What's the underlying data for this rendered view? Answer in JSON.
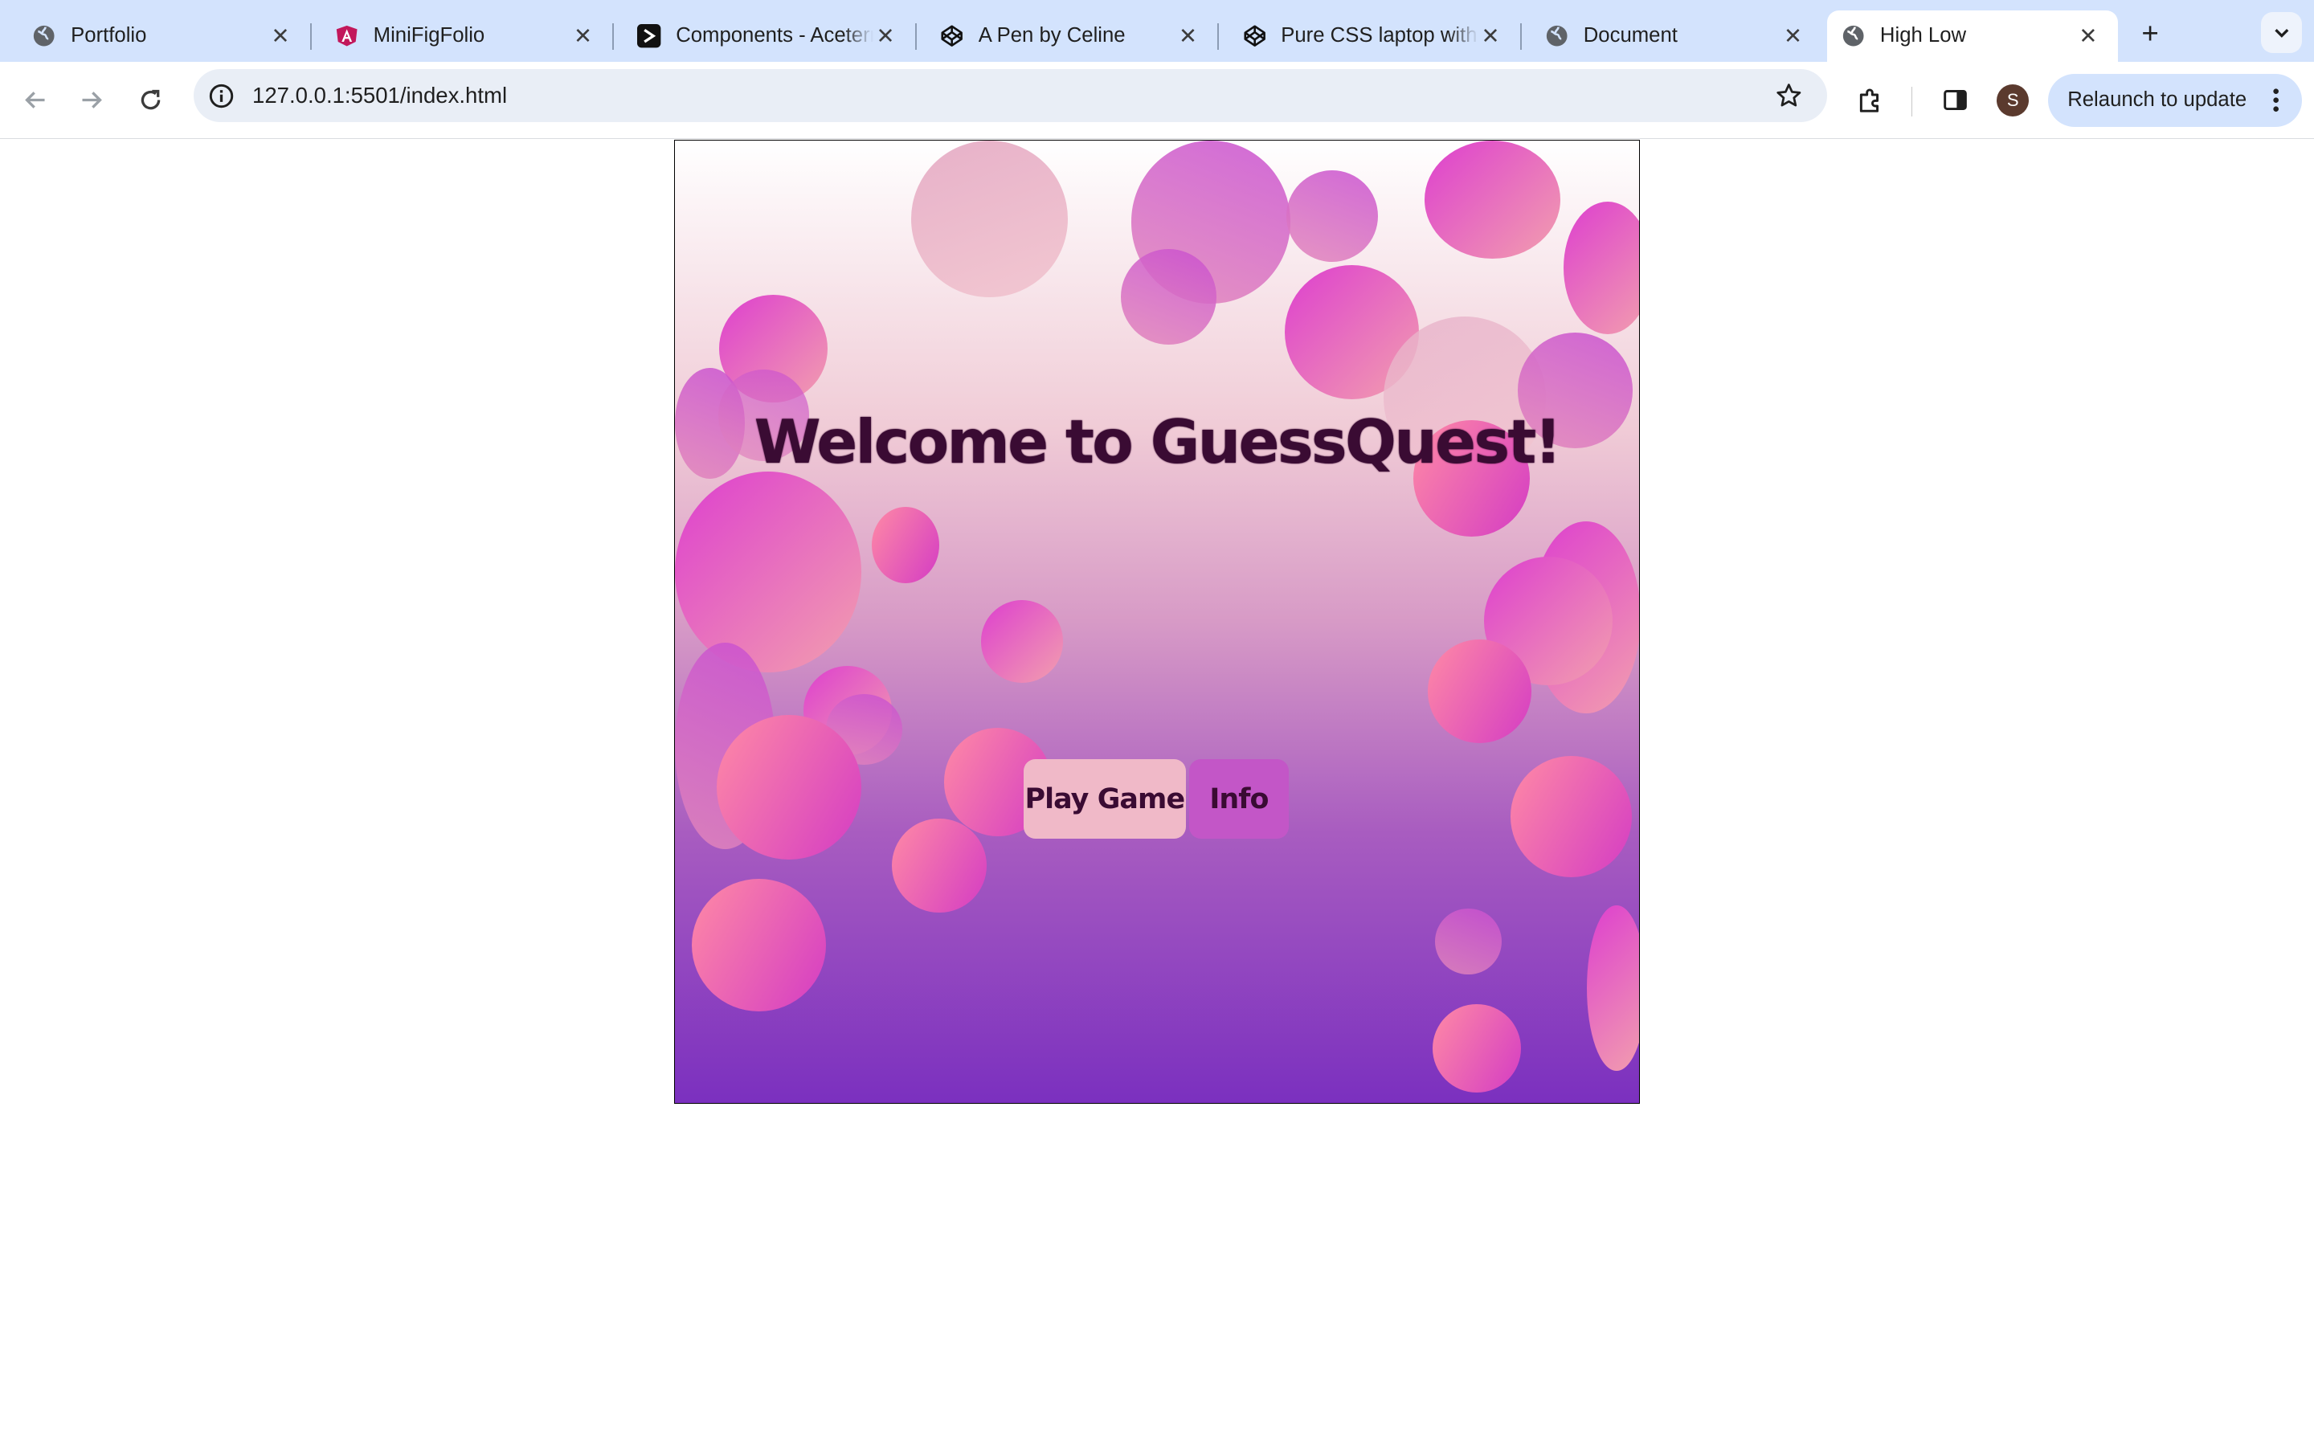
{
  "browser": {
    "tabs": [
      {
        "title": "Portfolio",
        "icon": "globe-icon",
        "active": false
      },
      {
        "title": "MiniFigFolio",
        "icon": "angular-logo-icon",
        "active": false
      },
      {
        "title": "Components - Aceternity UI",
        "icon": "aceternity-logo-icon",
        "active": false
      },
      {
        "title": "A Pen by Celine",
        "icon": "codepen-logo-icon",
        "active": false
      },
      {
        "title": "Pure CSS laptop with",
        "icon": "codepen-logo-icon",
        "active": false
      },
      {
        "title": "Document",
        "icon": "globe-icon",
        "active": false
      },
      {
        "title": "High Low",
        "icon": "globe-icon",
        "active": true
      }
    ],
    "new_tab_label": "+",
    "address": "127.0.0.1:5501/index.html",
    "profile_initial": "S",
    "relaunch_label": "Relaunch to update"
  },
  "game": {
    "title": "Welcome to GuessQuest!",
    "buttons": {
      "play_label": "Play Game",
      "info_label": "Info"
    }
  }
}
